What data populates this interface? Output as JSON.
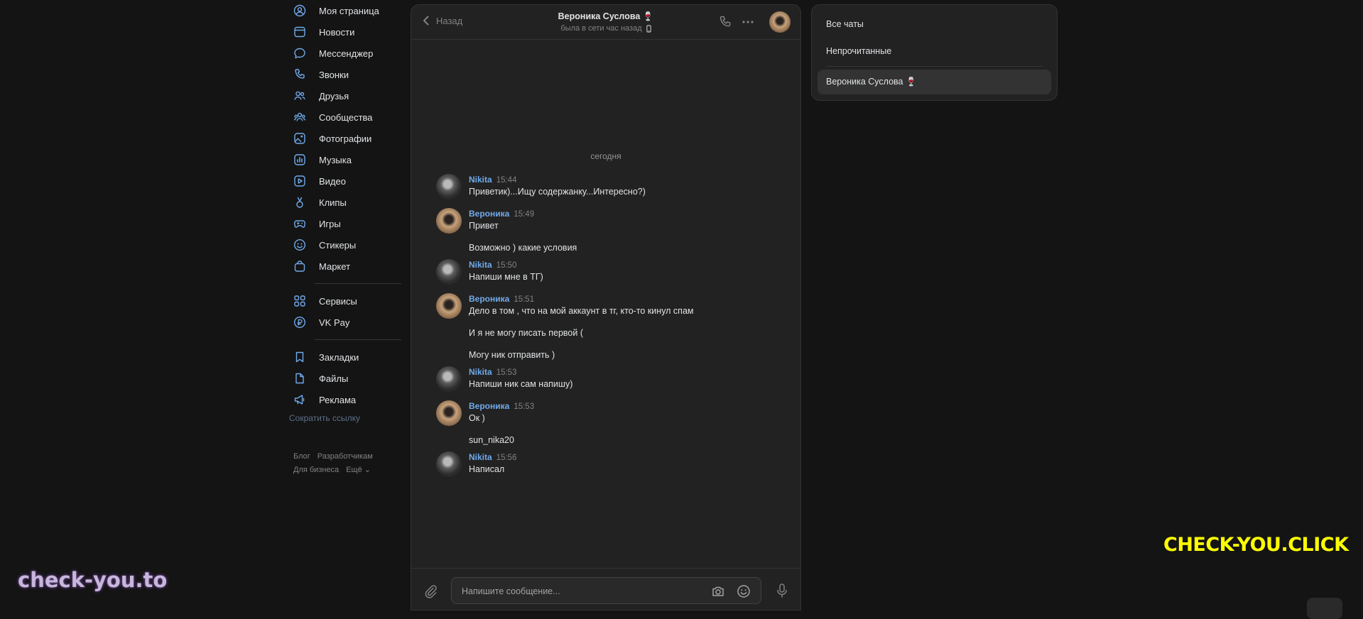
{
  "nav": {
    "items": [
      {
        "label": "Моя страница",
        "icon": "user-circle-icon"
      },
      {
        "label": "Новости",
        "icon": "newsfeed-icon"
      },
      {
        "label": "Мессенджер",
        "icon": "message-icon"
      },
      {
        "label": "Звонки",
        "icon": "phone-icon"
      },
      {
        "label": "Друзья",
        "icon": "users-icon"
      },
      {
        "label": "Сообщества",
        "icon": "community-icon"
      },
      {
        "label": "Фотографии",
        "icon": "photo-icon"
      },
      {
        "label": "Музыка",
        "icon": "music-icon"
      },
      {
        "label": "Видео",
        "icon": "video-icon"
      },
      {
        "label": "Клипы",
        "icon": "clips-icon"
      },
      {
        "label": "Игры",
        "icon": "gamepad-icon"
      },
      {
        "label": "Стикеры",
        "icon": "smile-icon"
      },
      {
        "label": "Маркет",
        "icon": "bag-icon"
      }
    ],
    "services": [
      {
        "label": "Сервисы",
        "icon": "services-icon"
      },
      {
        "label": "VK Pay",
        "icon": "vkpay-icon"
      }
    ],
    "extra": [
      {
        "label": "Закладки",
        "icon": "bookmark-icon"
      },
      {
        "label": "Файлы",
        "icon": "file-icon"
      },
      {
        "label": "Реклама",
        "icon": "megaphone-icon"
      }
    ],
    "short_link": "Сократить ссылку",
    "footer": {
      "blog": "Блог",
      "developers": "Разработчикам",
      "business": "Для бизнеса",
      "more": "Ещё"
    }
  },
  "chat": {
    "back_label": "Назад",
    "peer_name": "Вероника Суслова 🍷",
    "peer_status": "была в сети час назад",
    "date_separator": "сегодня",
    "messages": [
      {
        "author": "Nikita",
        "time": "15:44",
        "avatar": "nikita",
        "lines": [
          "Приветик)...Ищу содержанку...Интересно?)"
        ]
      },
      {
        "author": "Вероника",
        "time": "15:49",
        "avatar": "veronika",
        "lines": [
          "Привет",
          "Возможно ) какие условия"
        ]
      },
      {
        "author": "Nikita",
        "time": "15:50",
        "avatar": "nikita",
        "lines": [
          "Напиши мне в ТГ)"
        ]
      },
      {
        "author": "Вероника",
        "time": "15:51",
        "avatar": "veronika",
        "lines": [
          "Дело в том , что на мой аккаунт в тг, кто-то кинул спам",
          "И я не могу писать первой (",
          "Могу ник отправить )"
        ]
      },
      {
        "author": "Nikita",
        "time": "15:53",
        "avatar": "nikita",
        "lines": [
          "Напиши ник сам напишу)"
        ]
      },
      {
        "author": "Вероника",
        "time": "15:53",
        "avatar": "veronika",
        "lines": [
          "Ок )",
          "sun_nika20"
        ]
      },
      {
        "author": "Nikita",
        "time": "15:56",
        "avatar": "nikita",
        "lines": [
          "Написал"
        ]
      }
    ],
    "composer_placeholder": "Напишите сообщение..."
  },
  "filters": {
    "all_chats": "Все чаты",
    "unread": "Непрочитанные",
    "active_chat": "Вероника Суслова 🍷"
  },
  "watermarks": {
    "right": "CHECK-YOU.CLICK",
    "left": "check-you.to"
  },
  "colors": {
    "accent": "#71aaeb",
    "background": "#141414",
    "panel": "#222222",
    "watermark_right": "#ffff00"
  }
}
